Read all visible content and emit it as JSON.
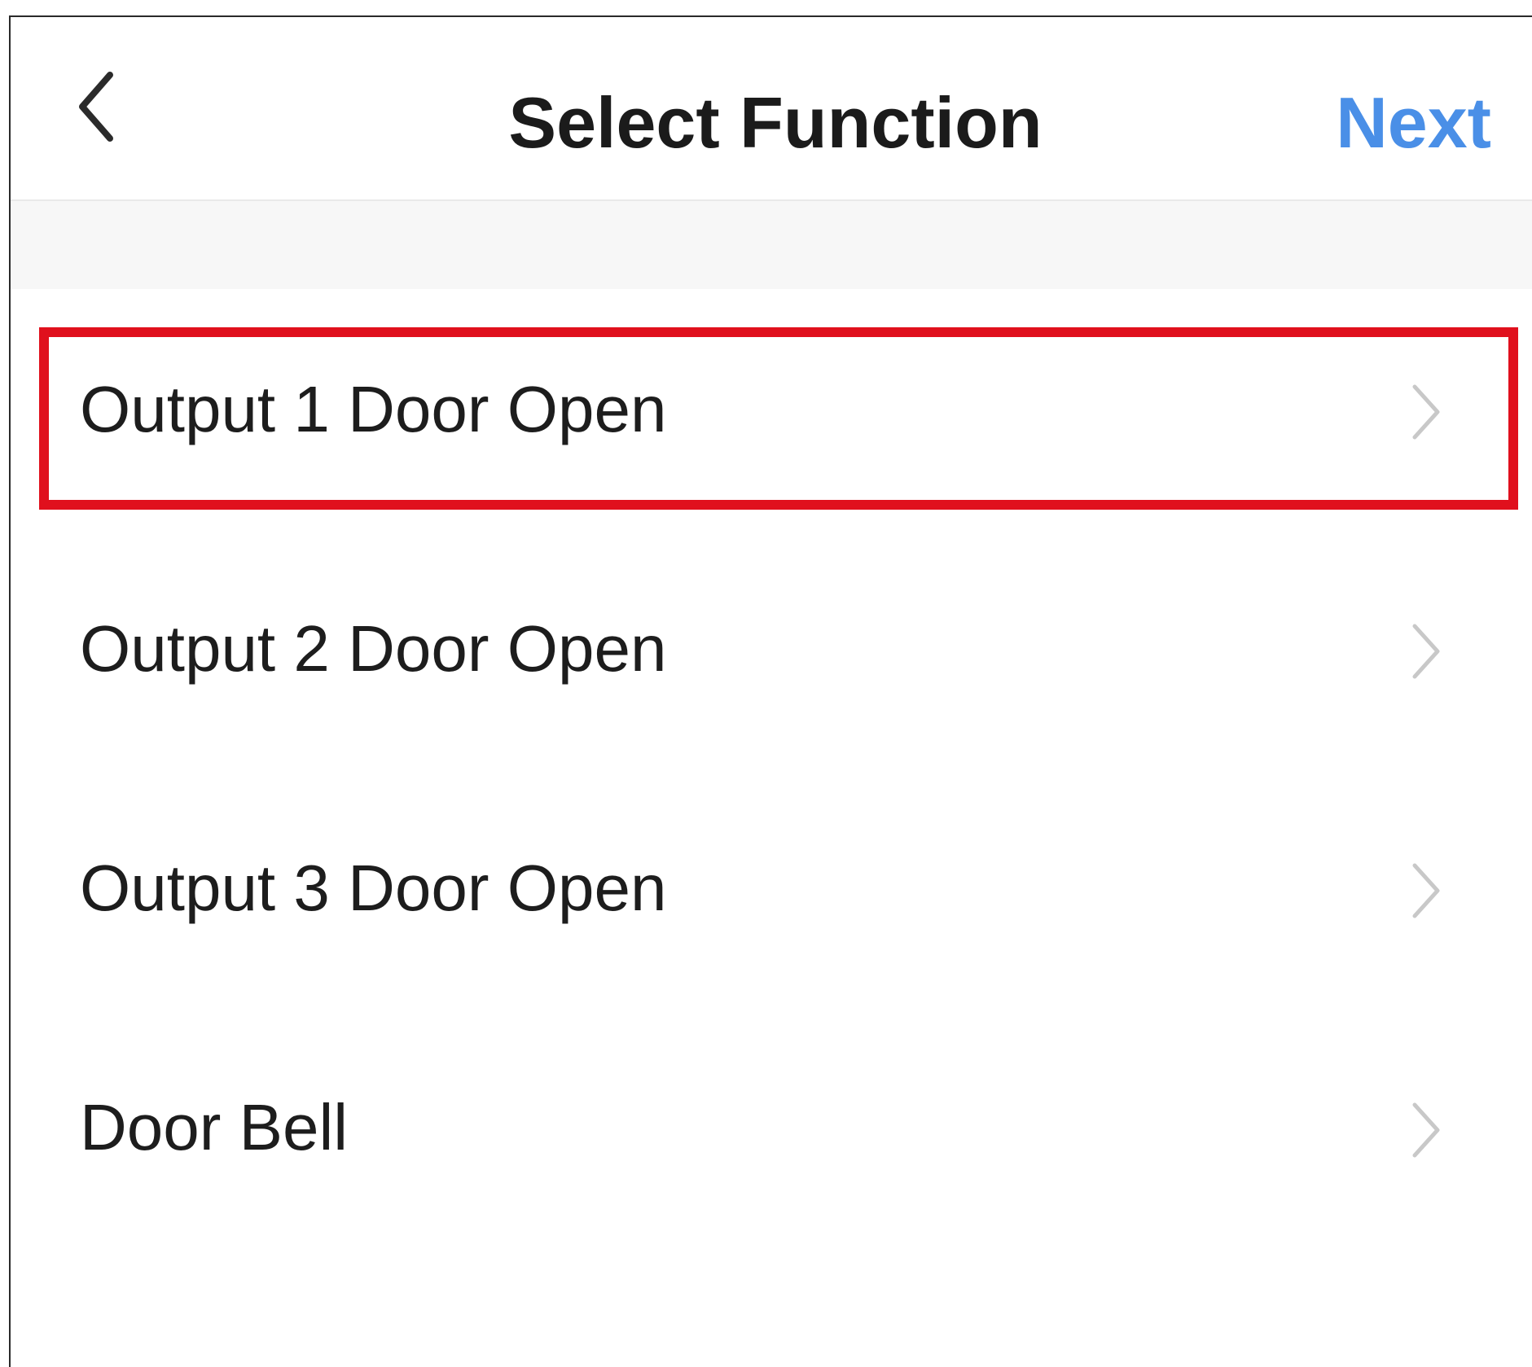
{
  "header": {
    "title": "Select Function",
    "next_label": "Next",
    "back_icon": "chevron-left-icon"
  },
  "colors": {
    "accent": "#4a8fe7",
    "highlight": "#e0101d",
    "text": "#1d1d1d",
    "chevron": "#c8c8c8",
    "section_bg": "#f7f7f7"
  },
  "functions": [
    {
      "label": "Output 1 Door Open",
      "icon": "chevron-right-icon",
      "highlighted": true
    },
    {
      "label": "Output 2 Door Open",
      "icon": "chevron-right-icon",
      "highlighted": false
    },
    {
      "label": "Output 3 Door Open",
      "icon": "chevron-right-icon",
      "highlighted": false
    },
    {
      "label": "Door Bell",
      "icon": "chevron-right-icon",
      "highlighted": false
    }
  ]
}
